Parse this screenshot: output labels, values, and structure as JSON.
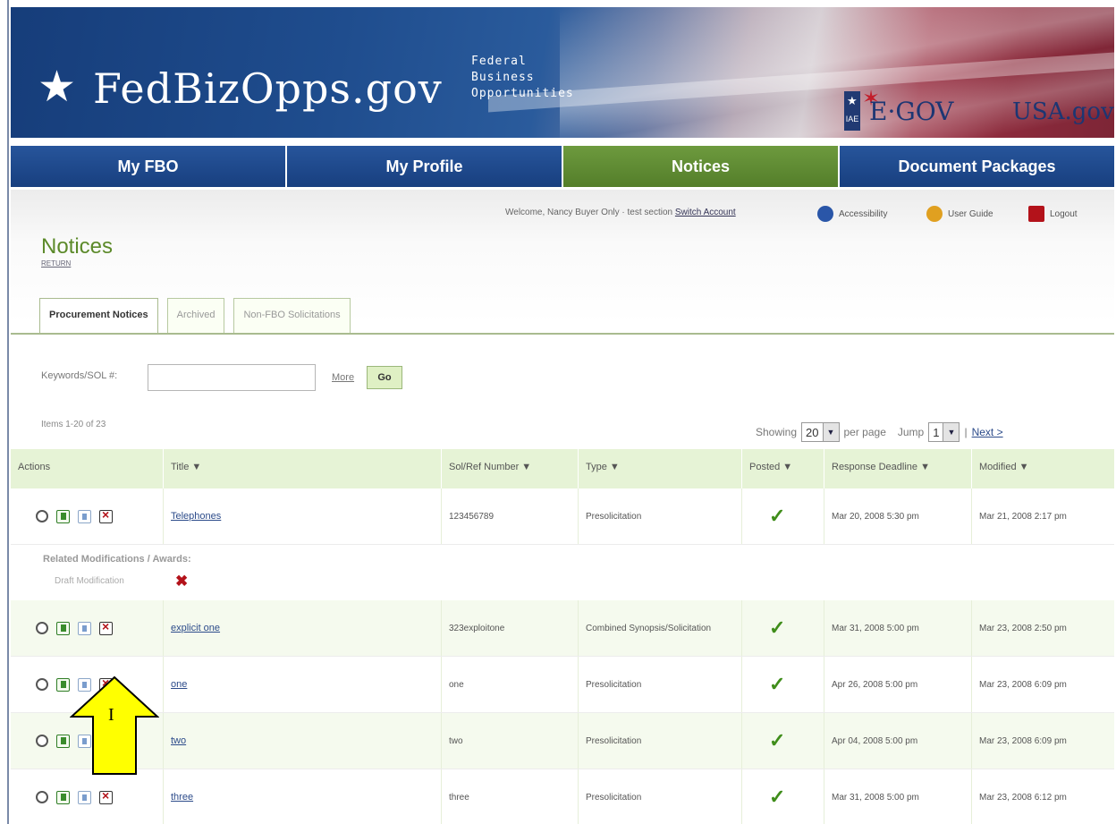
{
  "banner": {
    "logo_star": "★",
    "logo_text": "FedBizOpps.gov",
    "subtitle_line1": "Federal",
    "subtitle_line2": "Business",
    "subtitle_line3": "Opportunities",
    "iae": "IAE",
    "egov": "E·GOV",
    "usagov": "USA.gov"
  },
  "nav": [
    {
      "label": "My FBO"
    },
    {
      "label": "My Profile"
    },
    {
      "label": "Notices"
    },
    {
      "label": "Document Packages"
    }
  ],
  "utility": {
    "welcome": "Welcome, Nancy Buyer Only · test section",
    "switch_account": "Switch Account",
    "accessibility": "Accessibility",
    "user_guide": "User Guide",
    "logout": "Logout"
  },
  "page": {
    "title": "Notices",
    "return": "RETURN"
  },
  "tabs": [
    {
      "label": "Procurement Notices"
    },
    {
      "label": "Archived"
    },
    {
      "label": "Non-FBO Solicitations"
    }
  ],
  "search": {
    "label": "Keywords/SOL #:",
    "value": "",
    "more": "More",
    "go": "Go"
  },
  "listing": {
    "items_count": "Items 1-20 of 23",
    "showing": "Showing",
    "per_page_value": "20",
    "per_page": "per page",
    "jump": "Jump",
    "jump_value": "1",
    "next": "Next >"
  },
  "columns": [
    "Actions",
    "Title ▼",
    "Sol/Ref Number ▼",
    "Type ▼",
    "Posted ▼",
    "Response Deadline ▼",
    "Modified ▼"
  ],
  "rows": [
    {
      "title": "Telephones",
      "sol": "123456789",
      "type": "Presolicitation",
      "posted": "✓",
      "deadline": "Mar 20, 2008 5:30 pm",
      "modified": "Mar 21, 2008 2:17 pm"
    },
    {
      "title": "explicit one",
      "sol": "323exploitone",
      "type": "Combined Synopsis/Solicitation",
      "posted": "✓",
      "deadline": "Mar 31, 2008 5:00 pm",
      "modified": "Mar 23, 2008 2:50 pm"
    },
    {
      "title": "one",
      "sol": "one",
      "type": "Presolicitation",
      "posted": "✓",
      "deadline": "Apr 26, 2008 5:00 pm",
      "modified": "Mar 23, 2008 6:09 pm"
    },
    {
      "title": "two",
      "sol": "two",
      "type": "Presolicitation",
      "posted": "✓",
      "deadline": "Apr 04, 2008 5:00 pm",
      "modified": "Mar 23, 2008 6:09 pm"
    },
    {
      "title": "three",
      "sol": "three",
      "type": "Presolicitation",
      "posted": "✓",
      "deadline": "Mar 31, 2008 5:00 pm",
      "modified": "Mar 23, 2008 6:12 pm"
    }
  ],
  "related": {
    "label": "Related Modifications / Awards:",
    "draft": "Draft Modification",
    "delete": "✖"
  },
  "callout": {
    "label": "I"
  }
}
